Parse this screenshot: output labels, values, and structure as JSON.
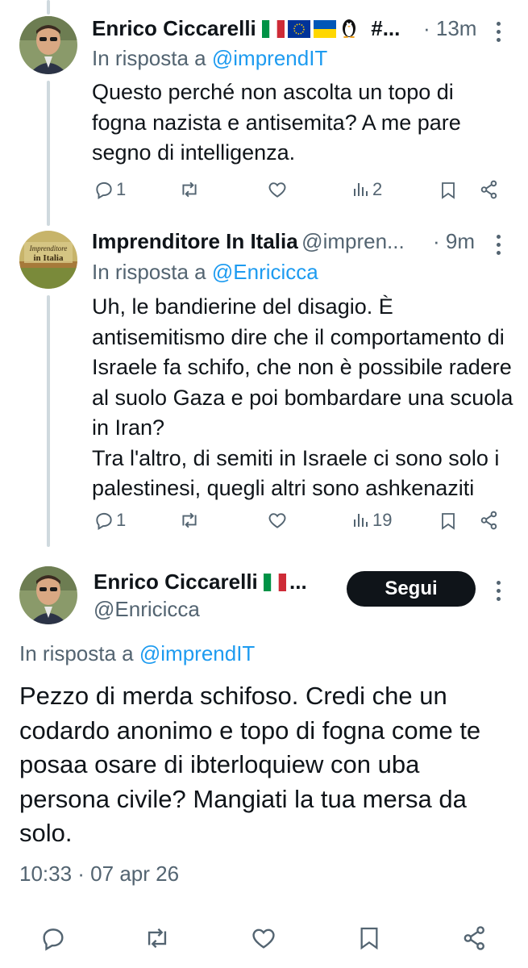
{
  "tweets": [
    {
      "author": "Enrico Ciccarelli",
      "handle_suffix": "#...",
      "time": "· 13m",
      "reply_prefix": "In risposta a",
      "reply_to": "@imprendIT",
      "text": "Questo perché non ascolta un topo di fogna nazista e antisemita? A me pare segno di intelligenza.",
      "replies": "1",
      "retweets": "",
      "likes": "",
      "views": "2"
    },
    {
      "author": "Imprenditore In Italia",
      "handle": "@impren...",
      "time": "· 9m",
      "reply_prefix": "In risposta a",
      "reply_to": "@Enricicca",
      "avatar_text": "Imprenditore in Italia",
      "text": "Uh, le bandierine del disagio. È antisemitismo dire che il comportamento di Israele fa schifo, che non è possibile radere al suolo Gaza e poi bombardare una scuola in Iran?\nTra l'altro, di semiti in Israele ci sono solo i palestinesi, quegli altri sono ashkenaziti",
      "replies": "1",
      "views": "19"
    }
  ],
  "main_tweet": {
    "author": "Enrico Ciccarelli",
    "handle": "@Enricicca",
    "follow_label": "Segui",
    "reply_prefix": "In risposta a",
    "reply_to": "@imprendIT",
    "text": "Pezzo di merda schifoso. Credi che un codardo anonimo e topo di fogna come te posaa osare di ibterloquiew con uba persona civile? Mangiati la tua mersa da solo.",
    "timestamp": "10:33 · 07 apr 26"
  },
  "colors": {
    "link": "#1d9bf0",
    "muted": "#536471",
    "text": "#0f1419",
    "thread_line": "#cfd9de"
  },
  "icons": [
    "reply-icon",
    "retweet-icon",
    "like-icon",
    "views-icon",
    "bookmark-icon",
    "share-icon",
    "more-icon",
    "flag-italy-icon",
    "flag-eu-icon",
    "flag-ukraine-icon",
    "penguin-icon"
  ]
}
